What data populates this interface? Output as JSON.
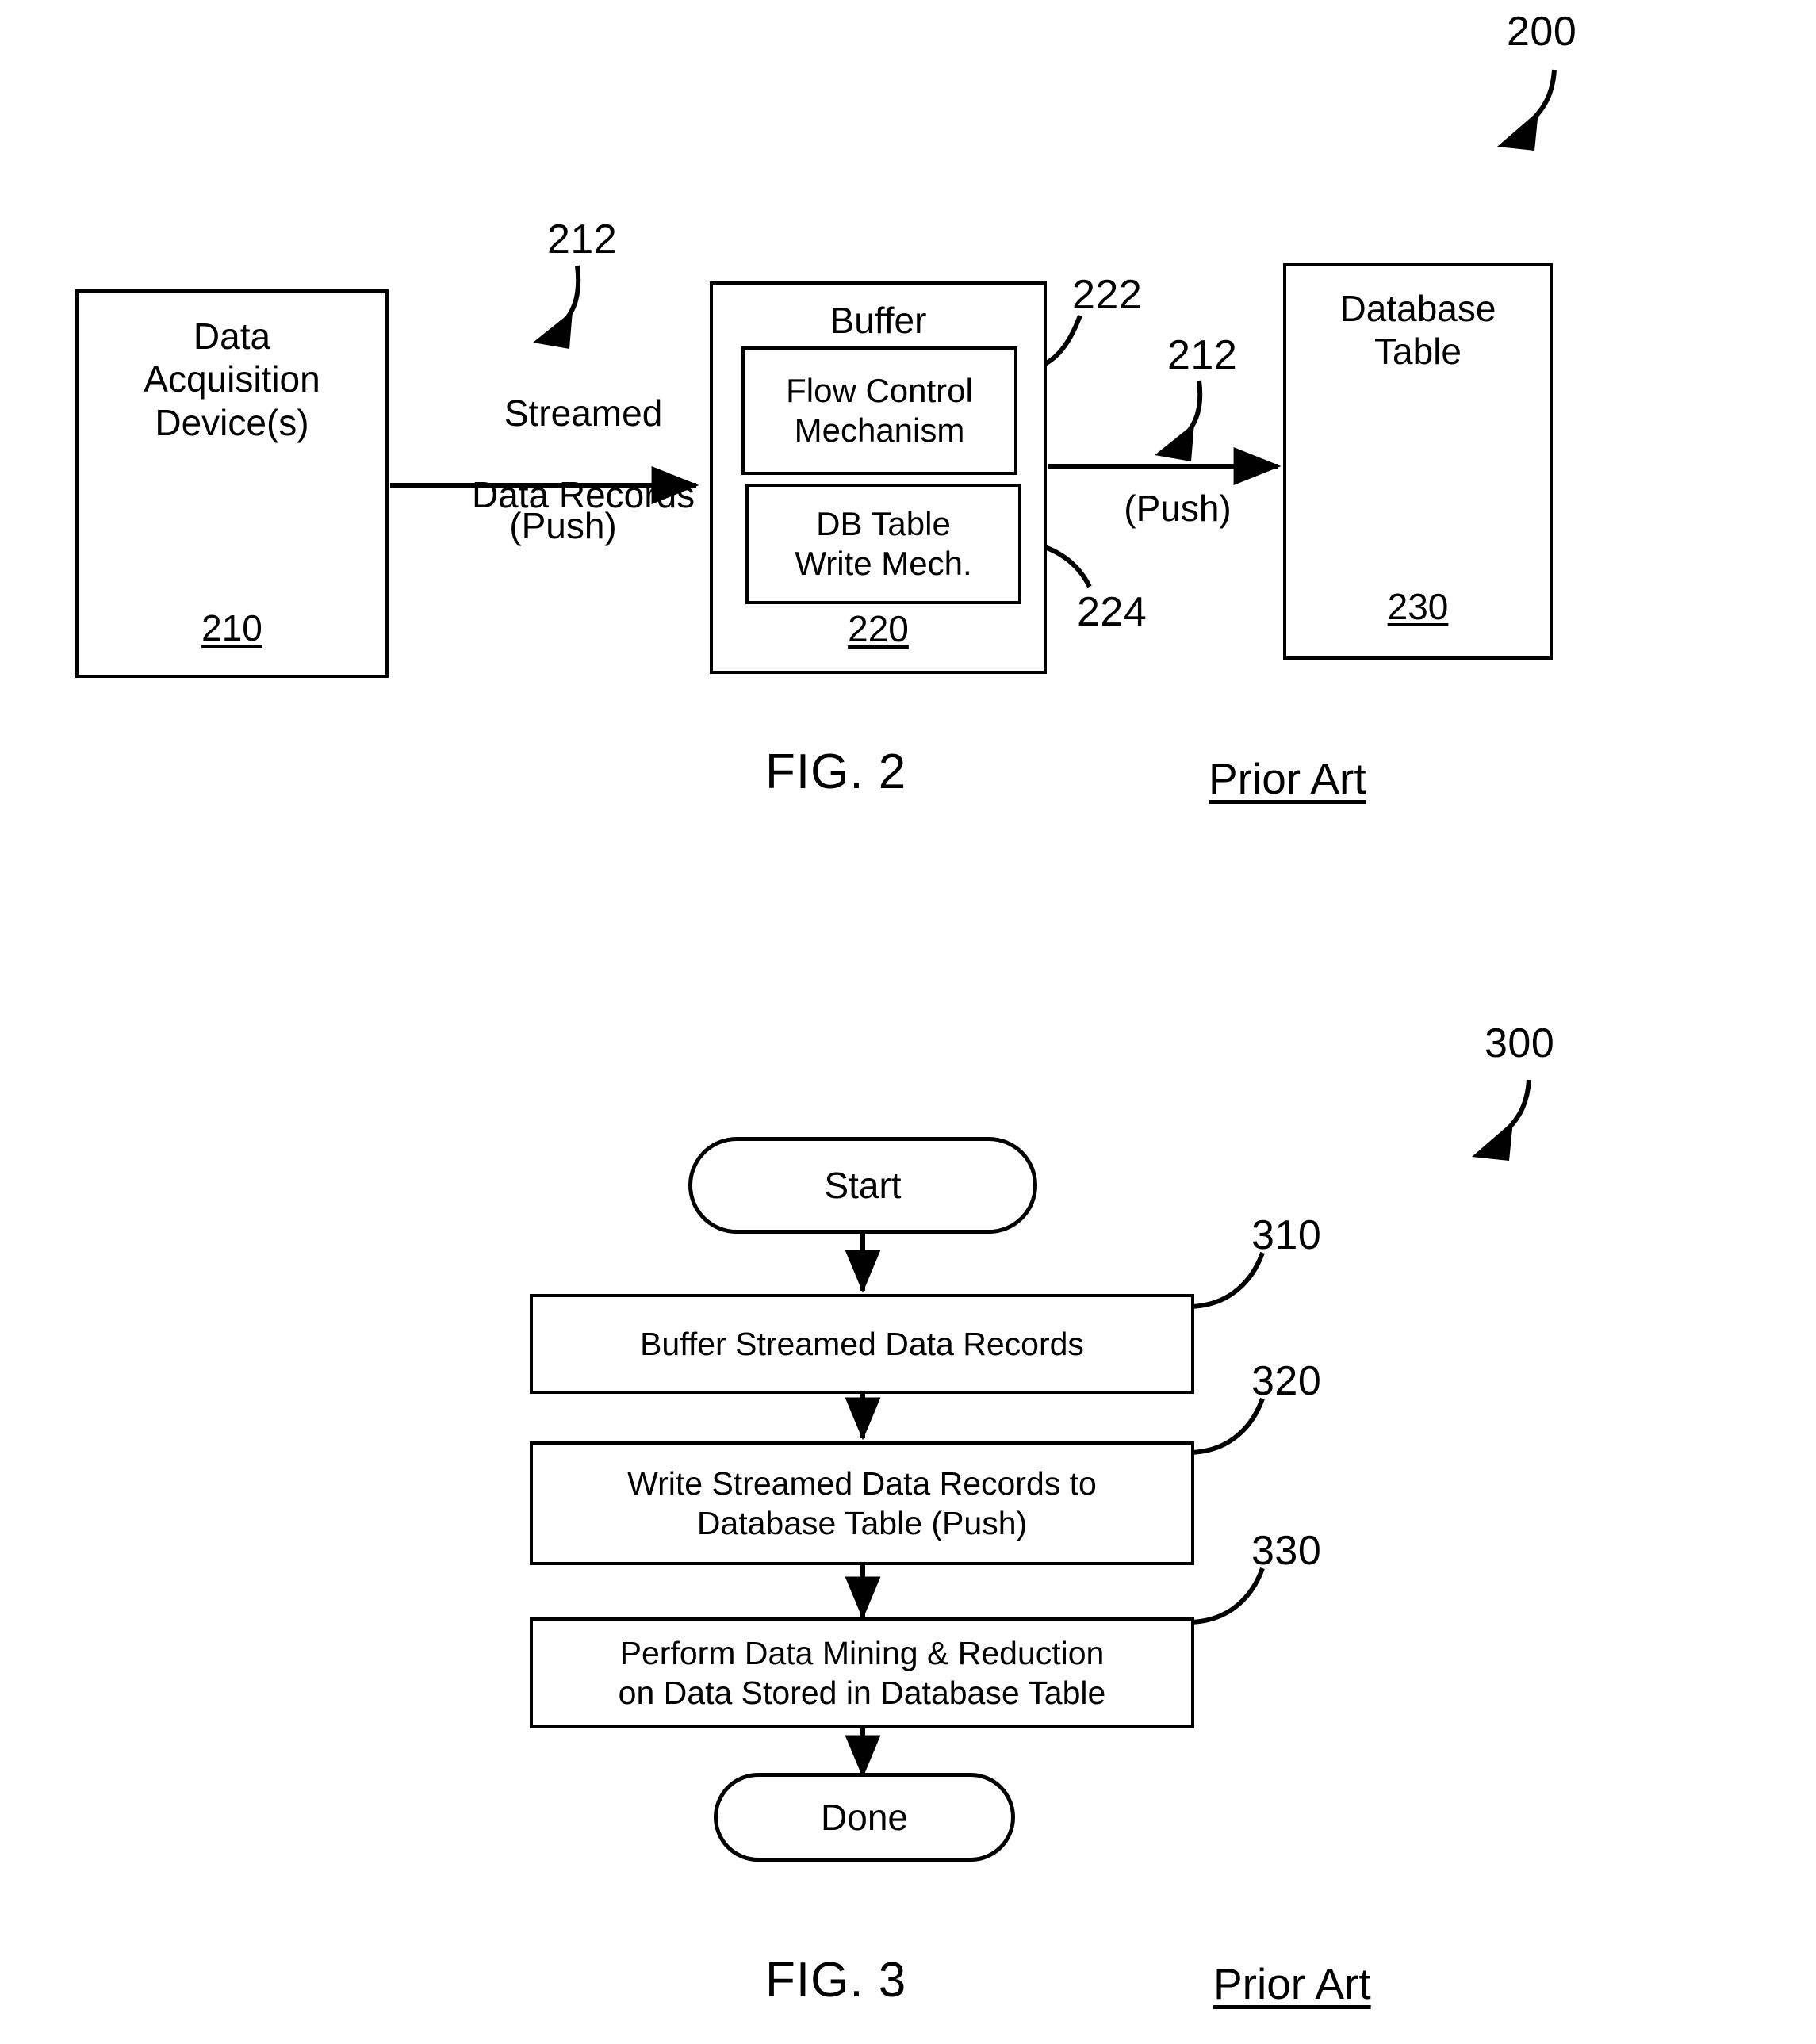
{
  "figure2": {
    "overall_ref": "200",
    "blocks": {
      "source": {
        "title_line1": "Data",
        "title_line2": "Acquisition",
        "title_line3": "Device(s)",
        "ref": "210"
      },
      "buffer": {
        "title": "Buffer",
        "ref": "220",
        "sub1": {
          "line1": "Flow Control",
          "line2": "Mechanism",
          "ref": "222"
        },
        "sub2": {
          "line1": "DB Table",
          "line2": "Write Mech.",
          "ref": "224"
        }
      },
      "database": {
        "title_line1": "Database",
        "title_line2": "Table",
        "ref": "230"
      }
    },
    "arrows": {
      "left": {
        "label_line1": "Streamed",
        "label_line2": "Data Records",
        "mode": "(Push)",
        "ref": "212"
      },
      "right": {
        "mode": "(Push)",
        "ref": "212"
      }
    },
    "caption": "FIG. 2",
    "prior_art": "Prior Art"
  },
  "figure3": {
    "overall_ref": "300",
    "start_label": "Start",
    "done_label": "Done",
    "steps": [
      {
        "line1": "Buffer Streamed Data Records",
        "line2": "",
        "ref": "310"
      },
      {
        "line1": "Write Streamed Data Records to",
        "line2": "Database Table (Push)",
        "ref": "320"
      },
      {
        "line1": "Perform Data Mining & Reduction",
        "line2": "on Data Stored in Database Table",
        "ref": "330"
      }
    ],
    "caption": "FIG. 3",
    "prior_art": "Prior Art"
  }
}
